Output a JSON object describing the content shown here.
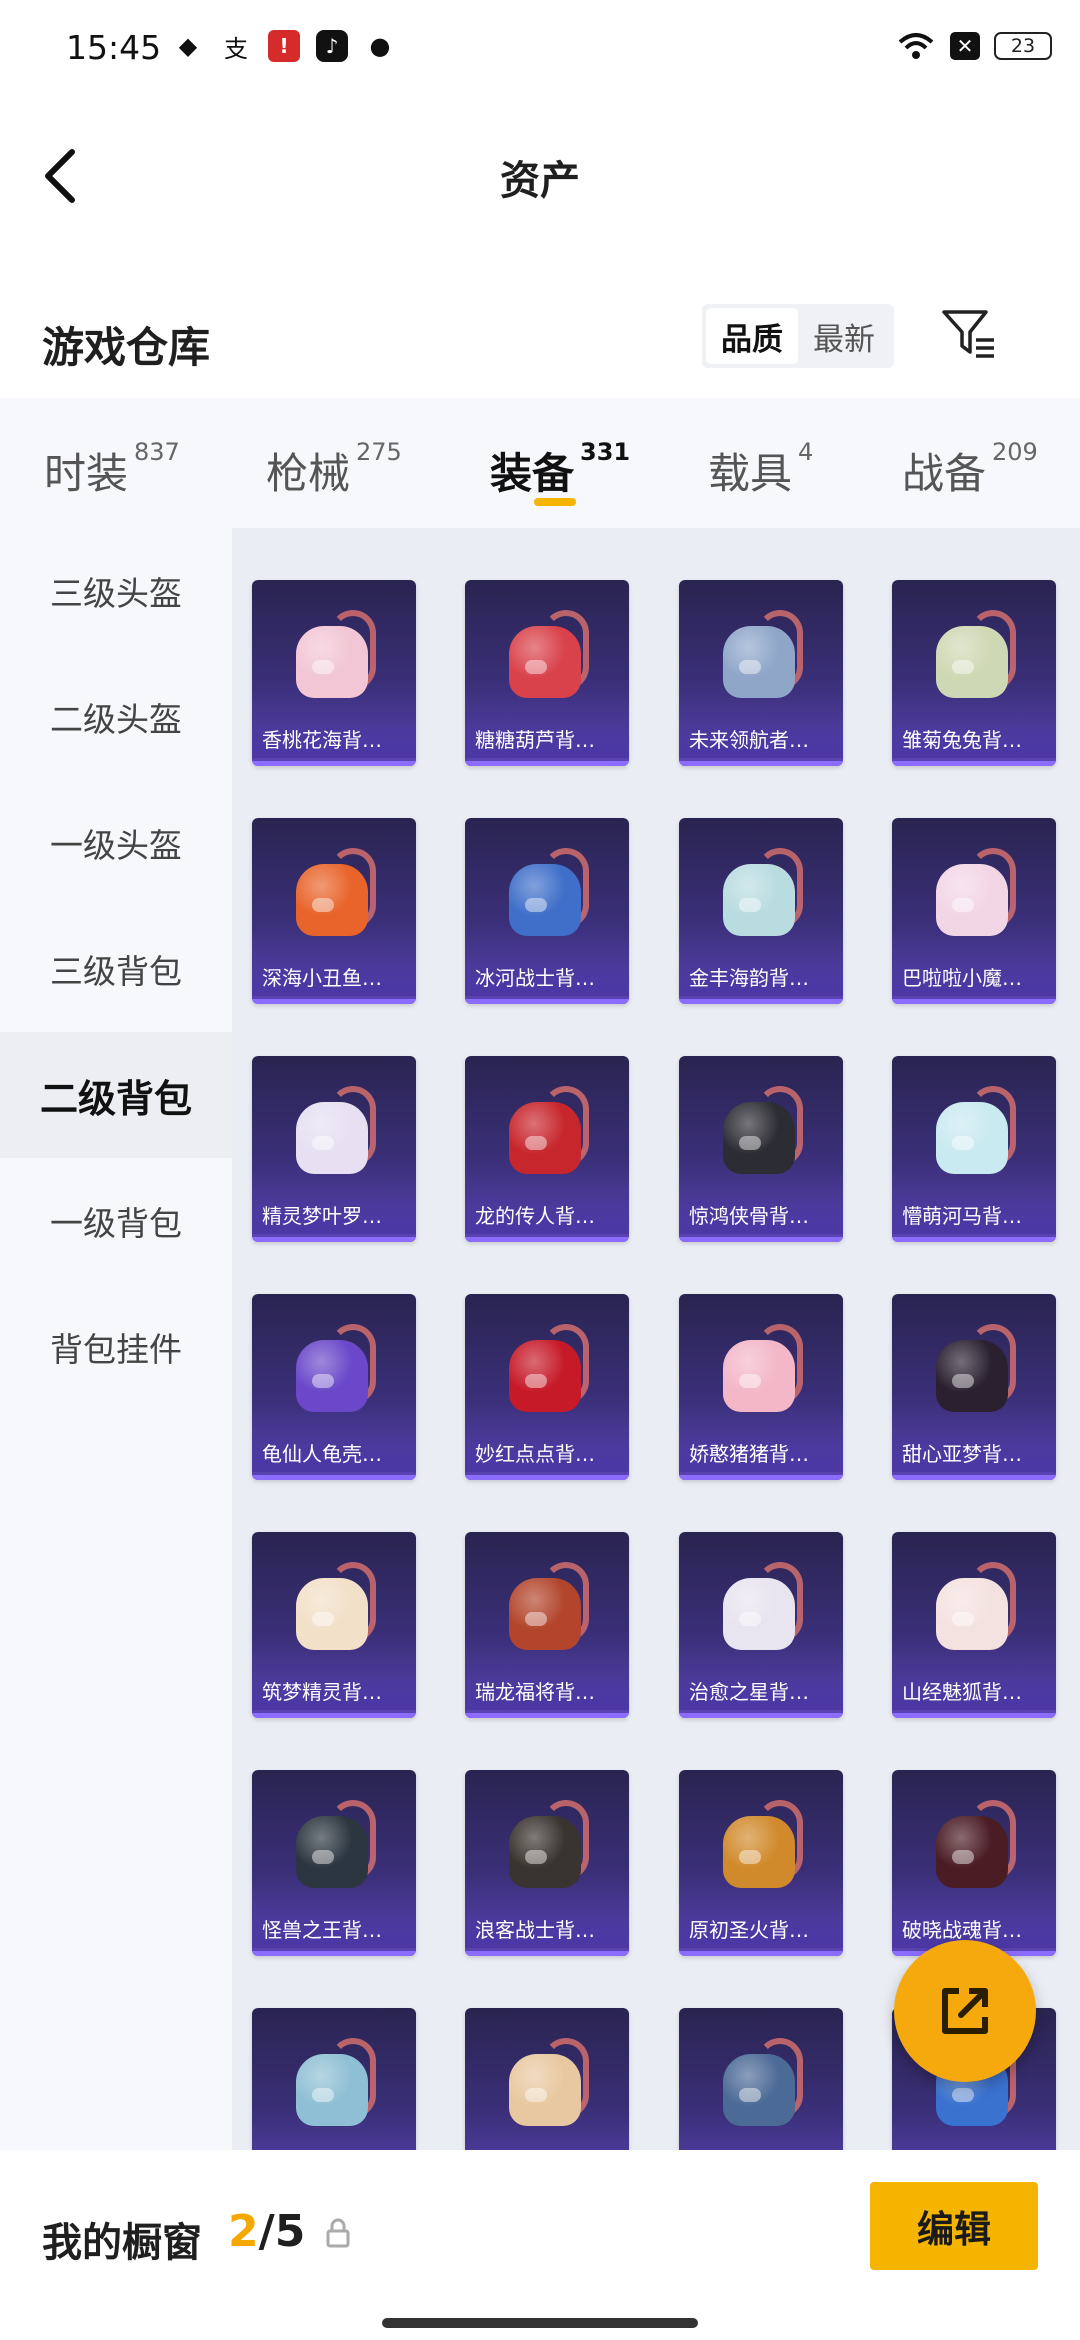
{
  "status_bar": {
    "time": "15:45",
    "battery": "23",
    "icons": [
      "shield-app-icon",
      "alipay-icon",
      "red-app-icon",
      "tiktok-icon",
      "wechat-icon"
    ],
    "icon_glyphs": [
      "◆",
      "支",
      "!",
      "♪",
      "●"
    ]
  },
  "header": {
    "title": "资产"
  },
  "warehouse": {
    "title": "游戏仓库",
    "sort_options": [
      "品质",
      "最新"
    ],
    "active_sort": "品质"
  },
  "tabs": [
    {
      "label": "时装",
      "count": "837"
    },
    {
      "label": "枪械",
      "count": "275"
    },
    {
      "label": "装备",
      "count": "331",
      "active": true
    },
    {
      "label": "载具",
      "count": "4"
    },
    {
      "label": "战备",
      "count": "209"
    }
  ],
  "side_menu": [
    {
      "label": "三级头盔"
    },
    {
      "label": "二级头盔"
    },
    {
      "label": "一级头盔"
    },
    {
      "label": "三级背包"
    },
    {
      "label": "二级背包",
      "active": true
    },
    {
      "label": "一级背包"
    },
    {
      "label": "背包挂件"
    }
  ],
  "items": [
    {
      "name": "香桃花海背…",
      "color": "#f2c6d4"
    },
    {
      "name": "糖糖葫芦背…",
      "color": "#d9424b"
    },
    {
      "name": "未来领航者…",
      "color": "#8fa6c9"
    },
    {
      "name": "雏菊兔兔背…",
      "color": "#cfd8b4"
    },
    {
      "name": "深海小丑鱼…",
      "color": "#e8642a"
    },
    {
      "name": "冰河战士背…",
      "color": "#3f6fc9"
    },
    {
      "name": "金丰海韵背…",
      "color": "#b9dce0"
    },
    {
      "name": "巴啦啦小魔…",
      "color": "#f3d6e6"
    },
    {
      "name": "精灵梦叶罗…",
      "color": "#e6e0f2"
    },
    {
      "name": "龙的传人背…",
      "color": "#c7262c"
    },
    {
      "name": "惊鸿侠骨背…",
      "color": "#2c2c34"
    },
    {
      "name": "懵萌河马背…",
      "color": "#c9eaf0"
    },
    {
      "name": "龟仙人龟壳…",
      "color": "#6a48c9"
    },
    {
      "name": "妙红点点背…",
      "color": "#c61a28"
    },
    {
      "name": "娇憨猪猪背…",
      "color": "#f3b7c8"
    },
    {
      "name": "甜心亚梦背…",
      "color": "#2a2030"
    },
    {
      "name": "筑梦精灵背…",
      "color": "#f2e0c8"
    },
    {
      "name": "瑞龙福将背…",
      "color": "#b2452c"
    },
    {
      "name": "治愈之星背…",
      "color": "#e8e4f0"
    },
    {
      "name": "山经魅狐背…",
      "color": "#f4e2e0"
    },
    {
      "name": "怪兽之王背…",
      "color": "#2c3640"
    },
    {
      "name": "浪客战士背…",
      "color": "#3a3430"
    },
    {
      "name": "原初圣火背…",
      "color": "#d08a2c"
    },
    {
      "name": "破晓战魂背…",
      "color": "#4a1c24"
    },
    {
      "name": "",
      "color": "#8fbfd4"
    },
    {
      "name": "",
      "color": "#e8c8a0"
    },
    {
      "name": "",
      "color": "#4c6a96"
    },
    {
      "name": "",
      "color": "#3a72d0"
    }
  ],
  "bottom_bar": {
    "label": "我的橱窗",
    "current": "2",
    "total": "/5",
    "edit_label": "编辑"
  },
  "colors": {
    "accent": "#f5b400",
    "fab": "#f6a90c",
    "card_top": "#2a2450",
    "card_bottom": "#5b44b5"
  }
}
